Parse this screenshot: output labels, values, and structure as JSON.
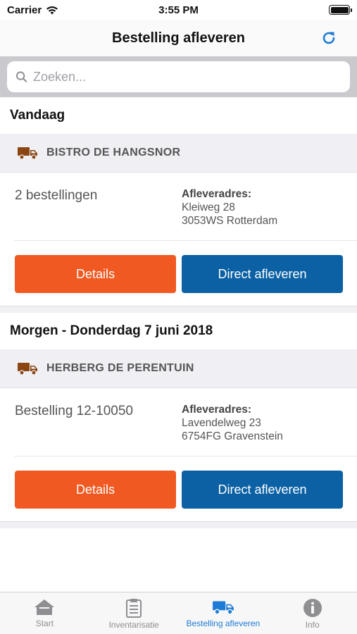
{
  "status": {
    "carrier": "Carrier",
    "time": "3:55 PM"
  },
  "nav": {
    "title": "Bestelling afleveren",
    "refresh_icon": "refresh-icon"
  },
  "search": {
    "placeholder": "Zoeken..."
  },
  "groups": [
    {
      "header": "Vandaag",
      "customer": "BISTRO DE HANGSNOR",
      "summary": "2 bestellingen",
      "address_label": "Afleveradres:",
      "address_line1": "Kleiweg 28",
      "address_line2": "3053WS Rotterdam",
      "details_label": "Details",
      "deliver_label": "Direct afleveren"
    },
    {
      "header": "Morgen - Donderdag 7 juni 2018",
      "customer": "HERBERG DE PERENTUIN",
      "summary": "Bestelling 12-10050",
      "address_label": "Afleveradres:",
      "address_line1": "Lavendelweg 23",
      "address_line2": "6754FG Gravenstein",
      "details_label": "Details",
      "deliver_label": "Direct afleveren"
    }
  ],
  "tabs": [
    {
      "label": "Start",
      "icon": "home-icon",
      "active": false
    },
    {
      "label": "Inventarisatie",
      "icon": "clipboard-icon",
      "active": false
    },
    {
      "label": "Bestelling afleveren",
      "icon": "truck-icon",
      "active": true
    },
    {
      "label": "Info",
      "icon": "info-icon",
      "active": false
    }
  ],
  "colors": {
    "details_button": "#f05a22",
    "deliver_button": "#0b61a4",
    "active_tab": "#1e7bd6",
    "truck_brown": "#8b4513"
  }
}
